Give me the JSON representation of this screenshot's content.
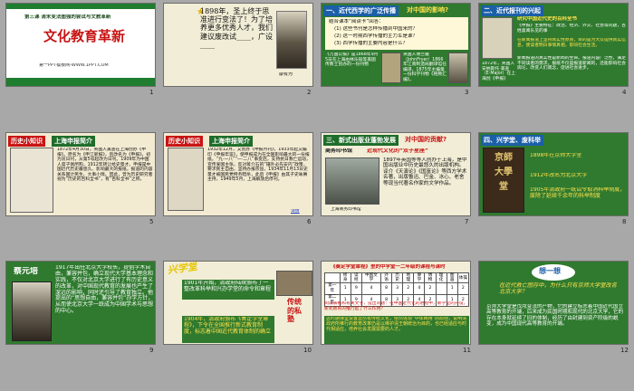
{
  "slides": [
    {
      "num": "1",
      "header": "第三课 清末变法图强的尝试与文教革新",
      "title": "文化教育革新",
      "footer": "第一PPT模板网-WWW.1PPT.COM"
    },
    {
      "num": "2",
      "text": "1898年，圣上终于思准进行变法了！为了培养更多优秀人才，我们建议废改试____，广设____",
      "caption": "康有为"
    },
    {
      "num": "3",
      "bar_left": "一、近代西学的广泛传播",
      "bar_right": "对中国的影响?",
      "question_head": "结合课本“阅读卡”回答：",
      "questions": [
        "(1) 这些书刊是怎样传播到中国来的？",
        "(2) 这一时期西学传播的主力军是谁？",
        "(3) 西学传播的主要内容是什么？"
      ],
      "book_cap": "《万国公报》是1868年9月5日在上海由林乐知等美国传教士创办的一份刊物",
      "person_cap": "英国人傅兰雅（JohnFryer）1866年江南制造局翻译馆任编译，1875年主编第一份科学刊物《格致汇编》。"
    },
    {
      "num": "4",
      "bar": "二、近代报刊的兴起",
      "subhead": "研究中国近代史的百科全书",
      "body1": "《申报》主要特征：政治、经济、外交、社会等问题，百姓喜闻乐见的事",
      "body2": "在新闻报道上坚持真实性原则，目的是为大众提供真实信息，使读者明白事情真相，影响社会生活。",
      "body3": "新闻报道的真实性是新闻的生命。报道内容广泛性，满足不同读者的需求。报纸不仅是报道新闻的，还能影响社会舆论，改变人们观念，促进社会进步。",
      "cap1": "1872年，英国人安纳斯托·美查（E·Major）在上海创《申报》"
    },
    {
      "num": "5",
      "tag": "历史小知识",
      "bar": "上海申报简介",
      "text": "1872年4月30日，英国人美查在上海创办《申报》。原名为《申江新报》，后改名为《申报》。初为双日刊，从第5号起改为日刊。1909年为中国人席子佩所购，1912年转让给史量才。申报是中国近代历史最悠久、影响最大的报纸，报道的内容关系国计民生、大事小情。因此，曾为历史研究者视为“历史的百科全书”，有“百科全书”之称。"
    },
    {
      "num": "6",
      "tag": "历史小知识",
      "bar": "上海申报简介",
      "text": "1932年12月，又创办《申报月刊》，1933年起又编印《申报年鉴》，使申报成为在全国影响最大的一份报纸。“九·一八”“一·二八”事变后，支持抗日救亡运动，宣传爱国主张，反对蒋介石的“攘外必先安内”政策，要求民主自由，坚持办报宗旨，1934年11月13日史量才被国民党特务暗杀，此后《申报》由其子史咏赓主持，1949年5月，上海解放后停刊。",
      "link": "详情"
    },
    {
      "num": "7",
      "bar_left": "三、新式出版业蓬勃发展",
      "bar_right": "对中国的贡献?",
      "org": "商务印书馆",
      "slogan": "近现代文化的“双子星座”",
      "text": "1897年英国等等人创办于上海，是中国出版业中历史最悠久的出版机构。译介《天演论》《国富论》等西方学术名著，出版鲁迅、巴金、冰心、老舍等现当代著名作家的文学作品。",
      "cap": "上海商务印书馆"
    },
    {
      "num": "8",
      "bar": "四、兴学堂、废科举",
      "items": [
        "1898年在京师大学堂",
        "1912年改名为北京大学",
        "1905年清政府一纸诏令取消科举制度，废除了延续千余年的科举制度"
      ],
      "plaque": "京師大學堂"
    },
    {
      "num": "9",
      "name": "蔡元培",
      "text": "1917年出任北京大学校长，提倡学术自由，兼容并包，确立现代大学基本理念和实践，不仅对北京大学进行了有历史意义的改革，对中国现代教育的发展也产生了深远的影响，同时还引导了教育独立。他提出的“思想自由，兼容并包”办学方针，从而使北京大学一跃成为中国学术与思想的中心。"
    },
    {
      "num": "10",
      "deco": "兴学堂",
      "event1": "1901年开始，清政府陆续颁布了一整改革科举和兴办学堂的命令和章程",
      "event2": "1904年，清政府颁布《奏定学堂章程》，下令在全国推行新式教育制度，标志着中国近代教育体制的确立",
      "side": "传统的私塾"
    },
    {
      "num": "11",
      "table_title": "《奏定学堂章程》里的中学堂一二年级的课程与课时",
      "headers": [
        "",
        "修身",
        "读经",
        "中国文学",
        "外语",
        "历史",
        "地理",
        "算学",
        "博物",
        "理化",
        "图画",
        "体操"
      ],
      "rows": [
        [
          "第一年",
          "1",
          "9",
          "4",
          "8",
          "3",
          "2",
          "4",
          "2",
          "",
          "1",
          "2"
        ],
        [
          "第二年",
          "1",
          "9",
          "4",
          "8",
          "3",
          "2",
          "4",
          "2",
          "",
          "1",
          "2"
        ]
      ],
      "note": "阅读表格和有关文字，提出问题：在中国近代化的进程中，新学堂的开设，新式教育的推行起了什么作用？",
      "summary": "这时期课堂设置显然有传统文化，依然体现“中体西用”的原则，说明清政府所推行的教育改革仍是以维护清王朝统治为目的，也已经适应与时代相适应，培养社会发展需要的人才。"
    },
    {
      "num": "12",
      "bubble": "想一想",
      "question": "在近代救亡图存中，为什么只有京师大学堂改名北京大学？",
      "answer": "京师大学堂是戊戌变法的产物，它的建立标志着中国近代国立高等教育的开端，后来成为民国时期和现代的北京大学，它的存在本身就延续了旧的体制，经历了由封建到资产阶级的蜕变，成为中国现代高等教育的开端。"
    }
  ],
  "colors": {
    "green_bg": "#2f7a2f",
    "cream_bg": "#f3ead2",
    "red": "#c81414",
    "blue": "#1b5fa8",
    "dark_green": "#1f5f1f"
  }
}
